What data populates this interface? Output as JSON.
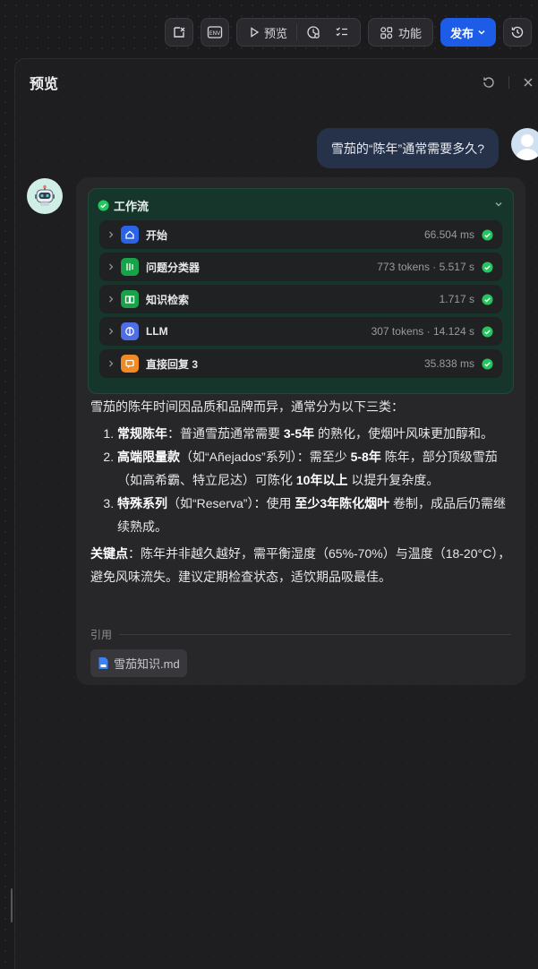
{
  "toolbar": {
    "preview_label": "预览",
    "feature_label": "功能",
    "publish_label": "发布"
  },
  "panel": {
    "title": "预览"
  },
  "user_message": "雪茄的“陈年”通常需要多久?",
  "workflow": {
    "title": "工作流",
    "items": [
      {
        "label": "开始",
        "meta": "66.504 ms",
        "icon": "home-icon",
        "color": "#2b63e6"
      },
      {
        "label": "问题分类器",
        "meta": "773 tokens · 5.517 s",
        "icon": "classifier-icon",
        "color": "#16a34a"
      },
      {
        "label": "知识检索",
        "meta": "1.717 s",
        "icon": "book-icon",
        "color": "#16a34a"
      },
      {
        "label": "LLM",
        "meta": "307 tokens · 14.124 s",
        "icon": "brain-icon",
        "color": "#4f6ee6"
      },
      {
        "label": "直接回复 3",
        "meta": "35.838 ms",
        "icon": "reply-icon",
        "color": "#f08a24"
      }
    ]
  },
  "answer": {
    "intro": "雪茄的陈年时间因品质和品牌而异，通常分为以下三类：",
    "item1_title": "常规陈年",
    "item1_a": "：普通雪茄通常需要 ",
    "item1_b": "3-5年",
    "item1_c": " 的熟化，使烟叶风味更加醇和。",
    "item2_title": "高端限量款",
    "item2_a": "（如“Añejados”系列）：需至少 ",
    "item2_b": "5-8年",
    "item2_c": " 陈年，部分顶级雪茄（如高希霸、特立尼达）可陈化 ",
    "item2_d": "10年以上",
    "item2_e": " 以提升复杂度。",
    "item3_title": "特殊系列",
    "item3_a": "（如“Reserva”）：使用 ",
    "item3_b": "至少3年陈化烟叶",
    "item3_c": " 卷制，成品后仍需继续熟成。",
    "key_title": "关键点",
    "key_text": "：陈年并非越久越好，需平衡湿度（65%-70%）与温度（18-20°C），避免风味流失。建议定期检查状态，适饮期品吸最佳。"
  },
  "reference": {
    "label": "引用",
    "file": "雪茄知识.md"
  },
  "colors": {
    "accent": "#1d5ce6",
    "success": "#22c55e",
    "workflow_bg": "#17362b"
  }
}
